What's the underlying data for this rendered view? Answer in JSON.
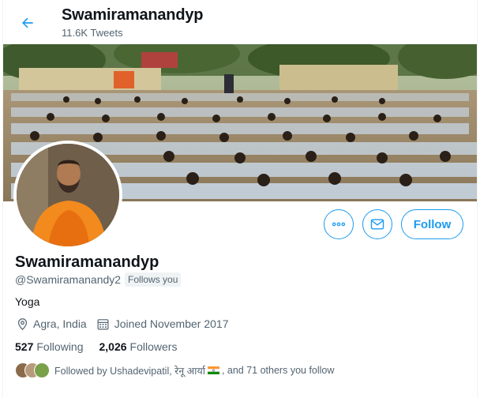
{
  "header": {
    "title": "Swamiramanandyp",
    "tweet_count": "11.6K Tweets",
    "back_icon": "arrow-left-icon"
  },
  "profile": {
    "name": "Swamiramanandyp",
    "handle": "@Swamiramanandy2",
    "follows_you": "Follows you",
    "bio": "Yoga",
    "location": "Agra, India",
    "joined": "Joined November 2017",
    "following_count": "527",
    "following_label": "Following",
    "followers_count": "2,026",
    "followers_label": "Followers",
    "followed_by_prefix": "Followed by Ushadevipatil, रेनू आर्या",
    "followed_by_suffix": ", and 71 others you follow"
  },
  "actions": {
    "more_icon": "more-options-icon",
    "message_icon": "mail-icon",
    "follow_label": "Follow"
  },
  "colors": {
    "accent": "#1d9bf0",
    "text_primary": "#0f1419",
    "text_secondary": "#536471"
  }
}
